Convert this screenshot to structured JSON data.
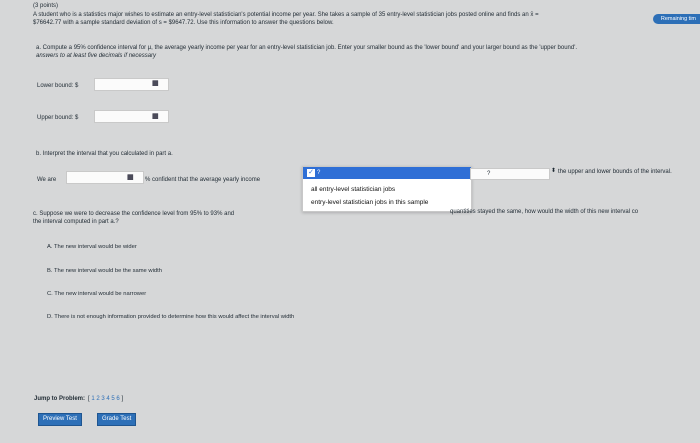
{
  "header": {
    "points": "(3 points)",
    "remaining_label": "Remaining tim"
  },
  "problem": {
    "line1": "A student who is a statistics major wishes to estimate an entry-level statistician's potential income per year. She takes a sample of 35 entry-level statistician jobs posted online and finds an x̄ =",
    "line2": "$76642.77 with a sample standard deviation of s = $9647.72. Use this information to answer the questions below."
  },
  "part_a": {
    "line1": "a. Compute a 95% confidence interval for μ, the average yearly income per year for an entry-level statistician job. Enter your smaller bound as the 'lower bound' and your larger bound as the 'upper bound'.",
    "line2": "answers to at least five decimals if necessary",
    "lower_label": "Lower bound: $",
    "upper_label": "Upper bound: $",
    "matrix_symbol": "▦"
  },
  "part_b": {
    "intro": "b. Interpret the interval that you calculated in part a.",
    "we_are": "We are",
    "confident_text": "% confident that the average yearly income",
    "selected_option": "?",
    "second_select": "?",
    "tail_text": "the upper and lower bounds of the interval.",
    "options": [
      "all entry-level statistician jobs",
      "entry-level statistician jobs in this sample"
    ]
  },
  "part_c": {
    "line1_start": "c. Suppose we were to decrease the confidence level from 95% to 93% and",
    "line1_end": "quantities stayed the same, how would the width of this new interval co",
    "line2": "the interval computed in part a.?",
    "options": [
      "A. The new interval would be wider",
      "B. The new interval would be the same width",
      "C. The new interval would be narrower",
      "D. There is not enough information provided to determine how this would affect the interval width"
    ]
  },
  "footer": {
    "jump_label": "Jump to Problem:",
    "problem_links": [
      "[",
      "1",
      "2",
      "3",
      "4",
      "5",
      "6",
      "]"
    ],
    "preview_button": "Preview Test",
    "grade_button": "Grade Test"
  }
}
